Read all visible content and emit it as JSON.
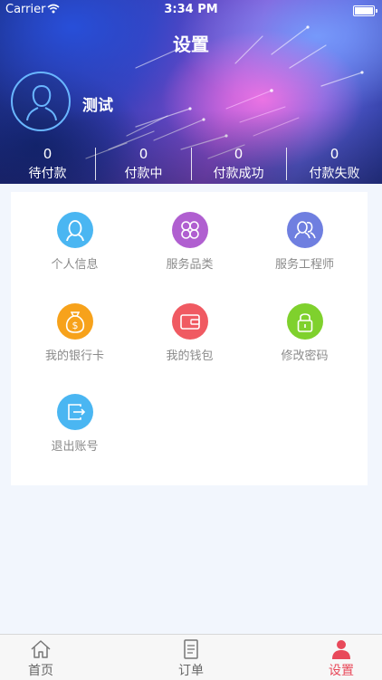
{
  "status_bar": {
    "carrier": "Carrier",
    "time": "3:34 PM",
    "battery_level": 1.0
  },
  "header": {
    "title": "设置"
  },
  "profile": {
    "username": "测试"
  },
  "stats": [
    {
      "count": "0",
      "label": "待付款"
    },
    {
      "count": "0",
      "label": "付款中"
    },
    {
      "count": "0",
      "label": "付款成功"
    },
    {
      "count": "0",
      "label": "付款失败"
    }
  ],
  "menu": [
    {
      "label": "个人信息",
      "icon": "person-icon",
      "color": "#4ab6f2"
    },
    {
      "label": "服务品类",
      "icon": "category-icon",
      "color": "#b05fd0"
    },
    {
      "label": "服务工程师",
      "icon": "engineers-icon",
      "color": "#6f7fe0"
    },
    {
      "label": "我的银行卡",
      "icon": "money-bag-icon",
      "color": "#f7a21b"
    },
    {
      "label": "我的钱包",
      "icon": "wallet-icon",
      "color": "#f05a62"
    },
    {
      "label": "修改密码",
      "icon": "lock-icon",
      "color": "#7fd12d"
    },
    {
      "label": "退出账号",
      "icon": "logout-icon",
      "color": "#4ab6f2"
    }
  ],
  "tabbar": {
    "items": [
      {
        "label": "首页",
        "icon": "home-icon"
      },
      {
        "label": "订单",
        "icon": "order-icon"
      },
      {
        "label": "设置",
        "icon": "user-icon"
      }
    ],
    "active_color": "#e8495a"
  }
}
